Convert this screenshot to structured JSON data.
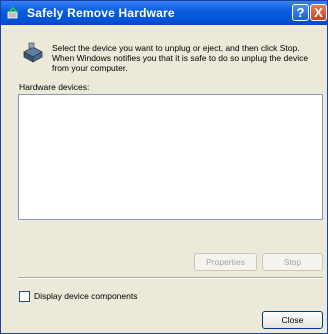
{
  "window": {
    "title": "Safely Remove Hardware",
    "help_button": "?",
    "close_button": "X"
  },
  "dialog": {
    "instruction": "Select the device you want to unplug or eject, and then click Stop. When Windows notifies you that it is safe to do so unplug the device from your computer.",
    "hardware_devices_label": "Hardware devices:",
    "hardware_devices": [],
    "properties_button": "Properties",
    "stop_button": "Stop",
    "display_components_label": "Display device components",
    "display_components_checked": false,
    "close_button": "Close"
  },
  "icons": {
    "title": "safely-remove-hardware-icon",
    "info": "hardware-device-icon"
  },
  "colors": {
    "titlebar": "#0a5fe0",
    "dialog_background": "#ece9d8",
    "listbox_border": "#7f9db9",
    "disabled_text": "#a5a49a"
  }
}
